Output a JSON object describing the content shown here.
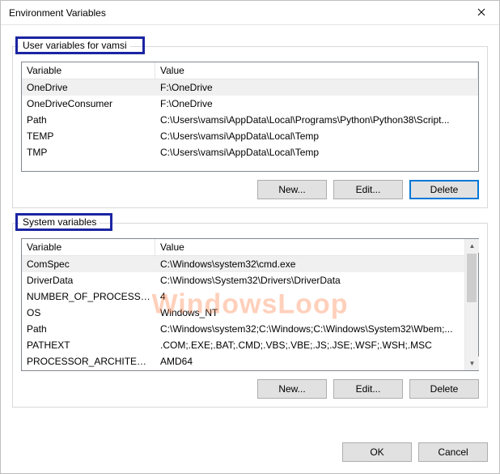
{
  "window": {
    "title": "Environment Variables"
  },
  "user_group": {
    "label": "User variables for vamsi",
    "columns": {
      "var": "Variable",
      "val": "Value"
    },
    "rows": [
      {
        "var": "OneDrive",
        "val": "F:\\OneDrive",
        "selected": true
      },
      {
        "var": "OneDriveConsumer",
        "val": "F:\\OneDrive"
      },
      {
        "var": "Path",
        "val": "C:\\Users\\vamsi\\AppData\\Local\\Programs\\Python\\Python38\\Script..."
      },
      {
        "var": "TEMP",
        "val": "C:\\Users\\vamsi\\AppData\\Local\\Temp"
      },
      {
        "var": "TMP",
        "val": "C:\\Users\\vamsi\\AppData\\Local\\Temp"
      }
    ],
    "buttons": {
      "new": "New...",
      "edit": "Edit...",
      "delete": "Delete"
    }
  },
  "system_group": {
    "label": "System variables",
    "columns": {
      "var": "Variable",
      "val": "Value"
    },
    "rows": [
      {
        "var": "ComSpec",
        "val": "C:\\Windows\\system32\\cmd.exe",
        "selected": true
      },
      {
        "var": "DriverData",
        "val": "C:\\Windows\\System32\\Drivers\\DriverData"
      },
      {
        "var": "NUMBER_OF_PROCESSORS",
        "val": "4"
      },
      {
        "var": "OS",
        "val": "Windows_NT"
      },
      {
        "var": "Path",
        "val": "C:\\Windows\\system32;C:\\Windows;C:\\Windows\\System32\\Wbem;..."
      },
      {
        "var": "PATHEXT",
        "val": ".COM;.EXE;.BAT;.CMD;.VBS;.VBE;.JS;.JSE;.WSF;.WSH;.MSC"
      },
      {
        "var": "PROCESSOR_ARCHITECTURE",
        "val": "AMD64"
      }
    ],
    "buttons": {
      "new": "New...",
      "edit": "Edit...",
      "delete": "Delete"
    }
  },
  "footer": {
    "ok": "OK",
    "cancel": "Cancel"
  },
  "watermark": "WindowsLoop"
}
